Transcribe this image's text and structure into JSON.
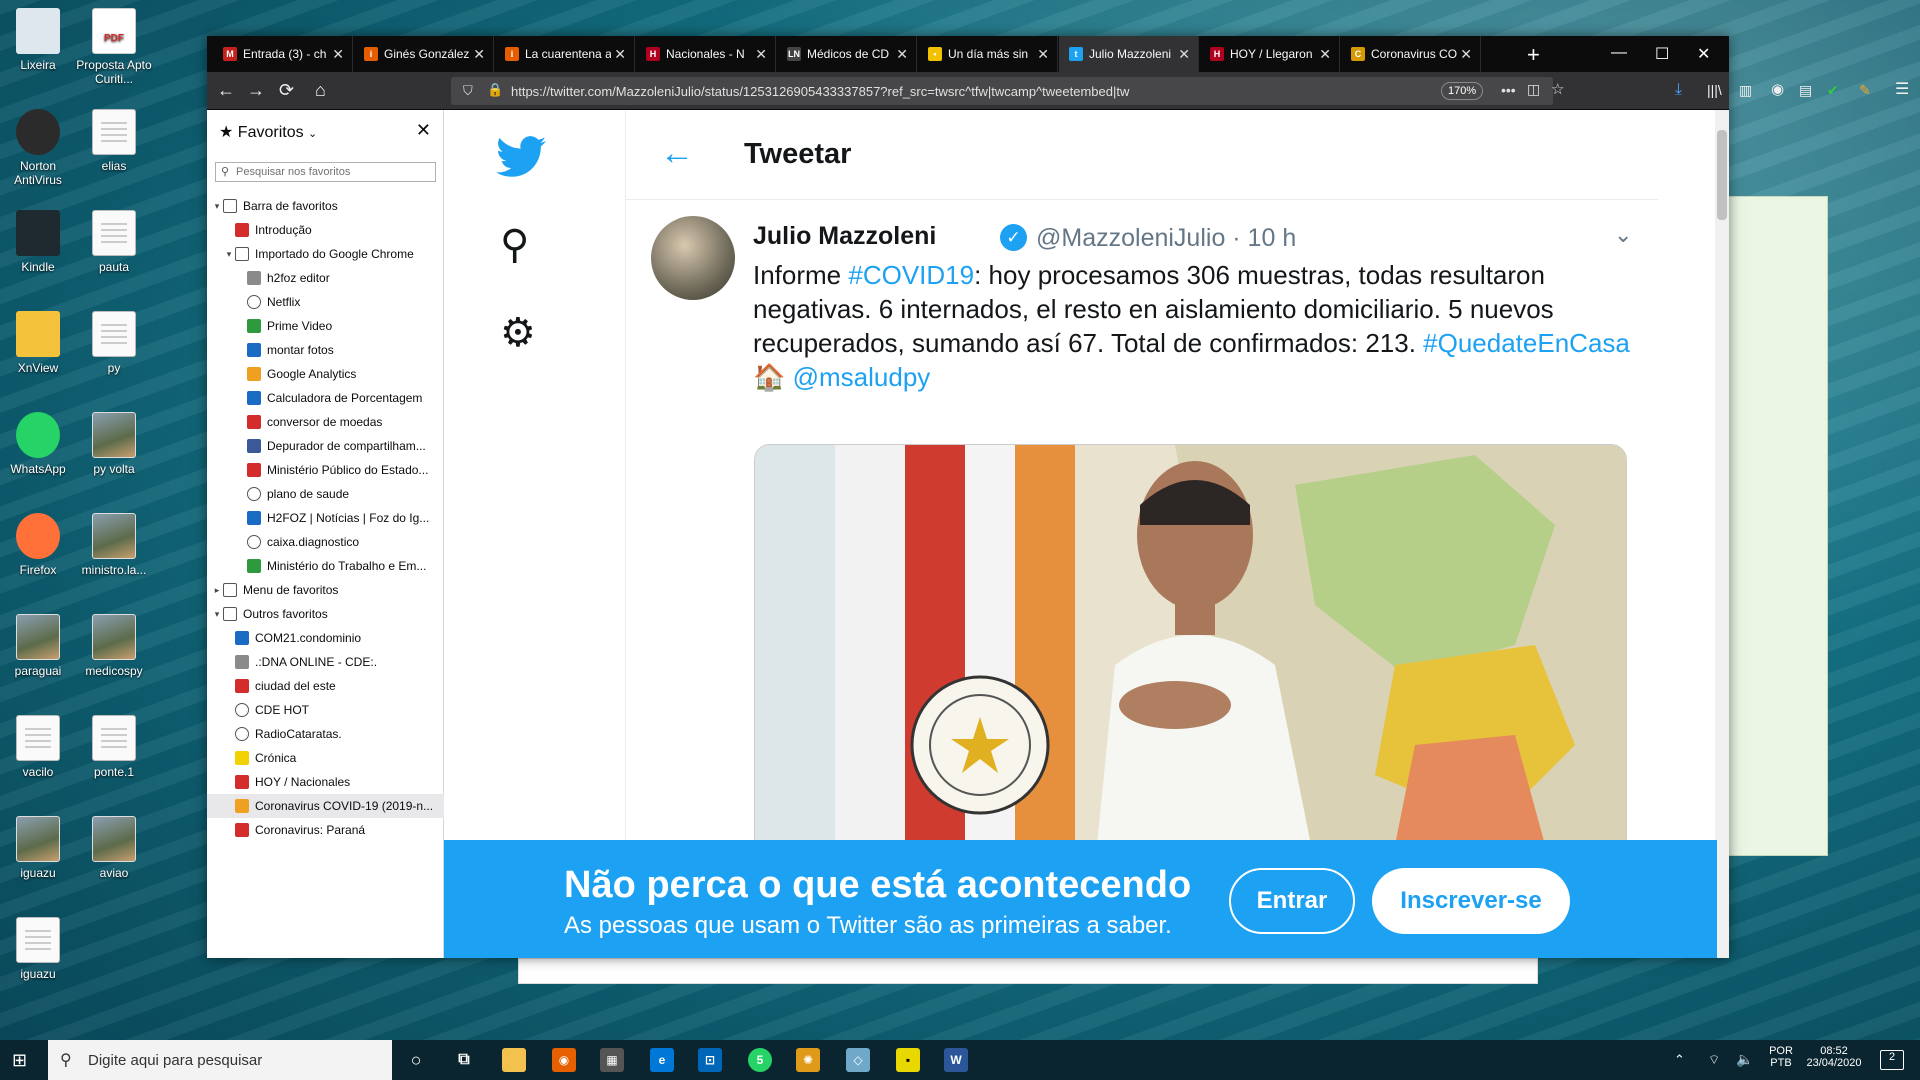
{
  "desktop": {
    "icons": [
      {
        "label": "Lixeira",
        "kind": "bin"
      },
      {
        "label": "Proposta Apto Curiti...",
        "kind": "pdf"
      },
      {
        "label": "Norton AntiVirus",
        "kind": "norton"
      },
      {
        "label": "elias",
        "kind": "doc"
      },
      {
        "label": "Kindle",
        "kind": "kindle"
      },
      {
        "label": "pauta",
        "kind": "doc"
      },
      {
        "label": "XnView",
        "kind": "xnview"
      },
      {
        "label": "py",
        "kind": "doc"
      },
      {
        "label": "WhatsApp",
        "kind": "whatsapp"
      },
      {
        "label": "py volta",
        "kind": "photo"
      },
      {
        "label": "Firefox",
        "kind": "firefox"
      },
      {
        "label": "ministro.la...",
        "kind": "photo"
      },
      {
        "label": "paraguai",
        "kind": "photo"
      },
      {
        "label": "medicospy",
        "kind": "photo"
      },
      {
        "label": "vacilo",
        "kind": "doc"
      },
      {
        "label": "ponte.1",
        "kind": "doc"
      },
      {
        "label": "iguazu",
        "kind": "photo"
      },
      {
        "label": "aviao",
        "kind": "photo"
      },
      {
        "label": "iguazu",
        "kind": "doc"
      }
    ],
    "pdf_badge": "PDF"
  },
  "browser": {
    "tabs": [
      {
        "label": "Entrada (3) - ch",
        "color": "#c5221f",
        "glyph": "M"
      },
      {
        "label": "Ginés González",
        "color": "#e65c00",
        "glyph": "i"
      },
      {
        "label": "La cuarentena a",
        "color": "#e65c00",
        "glyph": "i"
      },
      {
        "label": "Nacionales - N",
        "color": "#b00020",
        "glyph": "H"
      },
      {
        "label": "Médicos de CD",
        "color": "#444444",
        "glyph": "LN"
      },
      {
        "label": "Un día más sin",
        "color": "#f2c200",
        "glyph": "•"
      },
      {
        "label": "Julio Mazzoleni",
        "color": "#1da1f2",
        "glyph": "t",
        "active": true
      },
      {
        "label": "HOY / Llegaron",
        "color": "#b00020",
        "glyph": "H"
      },
      {
        "label": "Coronavirus CO",
        "color": "#d49a00",
        "glyph": "C"
      }
    ],
    "new_tab": "+",
    "window_controls": {
      "minimize": "—",
      "maximize": "☐",
      "close": "✕"
    },
    "url": "https://twitter.com/MazzoleniJulio/status/1253126905433337857?ref_src=twsrc^tfw|twcamp^tweetembed|tw",
    "zoom": "170%"
  },
  "sidebar": {
    "title": "Favoritos",
    "search_placeholder": "Pesquisar nos favoritos",
    "items": [
      {
        "label": "Barra de favoritos",
        "level": 0,
        "twisty": "open",
        "icon": "folder"
      },
      {
        "label": "Introdução",
        "level": 1,
        "icon": "red"
      },
      {
        "label": "Importado do Google Chrome",
        "level": 1,
        "twisty": "open",
        "icon": "folder"
      },
      {
        "label": "h2foz editor",
        "level": 2,
        "icon": "gray"
      },
      {
        "label": "Netflix",
        "level": 2,
        "icon": "globe"
      },
      {
        "label": "Prime Video",
        "level": 2,
        "icon": "green"
      },
      {
        "label": "montar fotos",
        "level": 2,
        "icon": "blue"
      },
      {
        "label": "Google Analytics",
        "level": 2,
        "icon": "orange"
      },
      {
        "label": "Calculadora de Porcentagem",
        "level": 2,
        "icon": "blue"
      },
      {
        "label": "conversor de moedas",
        "level": 2,
        "icon": "red"
      },
      {
        "label": "Depurador de compartilham...",
        "level": 2,
        "icon": "fb"
      },
      {
        "label": "Ministério Público do Estado...",
        "level": 2,
        "icon": "red"
      },
      {
        "label": "plano de saude",
        "level": 2,
        "icon": "globe"
      },
      {
        "label": "H2FOZ | Notícias | Foz do Ig...",
        "level": 2,
        "icon": "blue"
      },
      {
        "label": "caixa.diagnostico",
        "level": 2,
        "icon": "globe"
      },
      {
        "label": "Ministério do Trabalho e Em...",
        "level": 2,
        "icon": "green"
      },
      {
        "label": "Menu de favoritos",
        "level": 0,
        "twisty": "closed",
        "icon": "menu"
      },
      {
        "label": "Outros favoritos",
        "level": 0,
        "twisty": "open",
        "icon": "folder"
      },
      {
        "label": "COM21.condominio",
        "level": 1,
        "icon": "blue"
      },
      {
        "label": ".:DNA ONLINE - CDE:.",
        "level": 1,
        "icon": "gray"
      },
      {
        "label": "ciudad del este",
        "level": 1,
        "icon": "red"
      },
      {
        "label": "CDE HOT",
        "level": 1,
        "icon": "globe"
      },
      {
        "label": "RadioCataratas.",
        "level": 1,
        "icon": "globe"
      },
      {
        "label": "Crónica",
        "level": 1,
        "icon": "yellow"
      },
      {
        "label": "HOY / Nacionales",
        "level": 1,
        "icon": "red"
      },
      {
        "label": "Coronavirus COVID-19 (2019-n...",
        "level": 1,
        "icon": "orange",
        "selected": true
      },
      {
        "label": "Coronavirus: Paraná",
        "level": 1,
        "icon": "red"
      }
    ]
  },
  "twitter": {
    "page_title": "Tweetar",
    "author_name": "Julio Mazzoleni",
    "verified": "✓",
    "author_handle_time": "@MazzoleniJulio · 10 h",
    "text_parts": [
      {
        "t": "Informe ",
        "hl": false
      },
      {
        "t": "#COVID19",
        "hl": true
      },
      {
        "t": ": hoy procesamos 306 muestras, todas resultaron negativas. 6 internados, el resto en aislamiento domiciliario. 5 nuevos recuperados, sumando así 67. Total de confirmados: 213. ",
        "hl": false
      },
      {
        "t": "#QuedateEnCasa",
        "hl": true
      },
      {
        "t": " 🏠 ",
        "hl": false
      },
      {
        "t": "@msaludpy",
        "hl": true
      }
    ],
    "banner_title": "Não perca o que está acontecendo",
    "banner_subtitle": "As pessoas que usam o Twitter são as primeiras a saber.",
    "login_label": "Entrar",
    "signup_label": "Inscrever-se"
  },
  "taskbar": {
    "search_placeholder": "Digite aqui para pesquisar",
    "language": "POR",
    "layout": "PTB",
    "time": "08:52",
    "date": "23/04/2020",
    "notifications": "2",
    "whatsapp_badge": "5"
  }
}
